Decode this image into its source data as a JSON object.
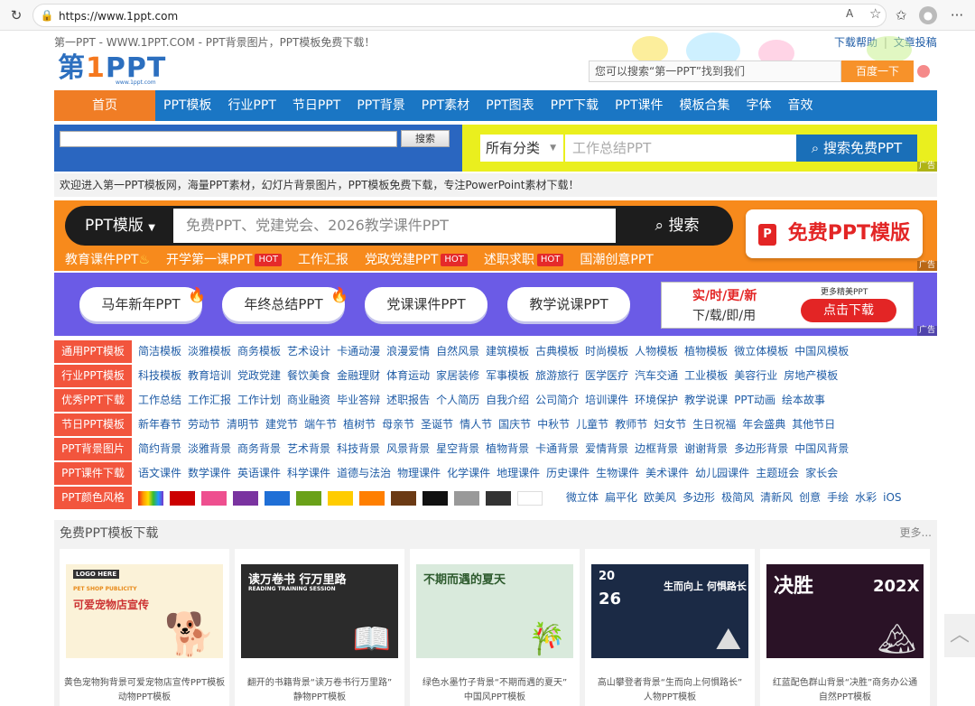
{
  "browser": {
    "url": "https://www.1ppt.com",
    "read_aloud": "A",
    "menu": "···"
  },
  "top_strip": {
    "slogan": "第一PPT - WWW.1PPT.COM - PPT背景图片，PPT模板免费下载！",
    "links": [
      "下载帮助",
      "文章投稿"
    ],
    "separator": "|"
  },
  "logo": {
    "text_a": "第",
    "text_b": "1",
    "text_c": "PPT",
    "url_text": "www.1ppt.com"
  },
  "top_search": {
    "placeholder": "您可以搜索“第一PPT”找到我们",
    "button": "百度一下"
  },
  "nav": {
    "home": "首页",
    "items": [
      "PPT模板",
      "行业PPT",
      "节日PPT",
      "PPT背景",
      "PPT素材",
      "PPT图表",
      "PPT下载",
      "PPT课件",
      "模板合集",
      "字体",
      "音效"
    ]
  },
  "search_band": {
    "left_button": "搜索",
    "select_value": "所有分类",
    "right_placeholder": "工作总结PPT",
    "right_button": "搜索免费PPT",
    "ad_label": "广告"
  },
  "welcome": "欢迎进入第一PPT模板网，海量PPT素材，幻灯片背景图片，PPT模板免费下载，专注PowerPoint素材下载！",
  "orange_banner": {
    "dropdown": "PPT模版",
    "placeholder": "免费PPT、党建党会、2026教学课件PPT",
    "search": "搜索",
    "cta": "免费PPT模版",
    "hot_label": "HOT",
    "keywords": [
      {
        "text": "教育课件PPT",
        "hot": false
      },
      {
        "text": "开学第一课PPT",
        "hot": true
      },
      {
        "text": "工作汇报",
        "hot": false
      },
      {
        "text": "党政党建PPT",
        "hot": true
      },
      {
        "text": "述职求职",
        "hot": true
      },
      {
        "text": "国潮创意PPT",
        "hot": false
      }
    ],
    "ad_label": "广告"
  },
  "purple_banner": {
    "buttons": [
      "马年新年PPT",
      "年终总结PPT",
      "党课课件PPT",
      "教学说课PPT"
    ],
    "ad_line1": "实/时/更/新",
    "ad_line2": "下/载/即/用",
    "ad_line3": "更多精美PPT",
    "ad_button": "点击下载",
    "ad_label": "广告"
  },
  "categories": [
    {
      "label": "通用PPT模板",
      "links": [
        "简洁模板",
        "淡雅模板",
        "商务模板",
        "艺术设计",
        "卡通动漫",
        "浪漫爱情",
        "自然风景",
        "建筑模板",
        "古典模板",
        "时尚模板",
        "人物模板",
        "植物模板",
        "微立体模板",
        "中国风模板"
      ]
    },
    {
      "label": "行业PPT模板",
      "links": [
        "科技模板",
        "教育培训",
        "党政党建",
        "餐饮美食",
        "金融理财",
        "体育运动",
        "家居装修",
        "军事模板",
        "旅游旅行",
        "医学医疗",
        "汽车交通",
        "工业模板",
        "美容行业",
        "房地产模板"
      ]
    },
    {
      "label": "优秀PPT下载",
      "links": [
        "工作总结",
        "工作汇报",
        "工作计划",
        "商业融资",
        "毕业答辩",
        "述职报告",
        "个人简历",
        "自我介绍",
        "公司简介",
        "培训课件",
        "环境保护",
        "教学说课",
        "PPT动画",
        "绘本故事"
      ]
    },
    {
      "label": "节日PPT模板",
      "links": [
        "新年春节",
        "劳动节",
        "清明节",
        "建党节",
        "端午节",
        "植树节",
        "母亲节",
        "圣诞节",
        "情人节",
        "国庆节",
        "中秋节",
        "儿童节",
        "教师节",
        "妇女节",
        "生日祝福",
        "年会盛典",
        "其他节日"
      ]
    },
    {
      "label": "PPT背景图片",
      "links": [
        "简约背景",
        "淡雅背景",
        "商务背景",
        "艺术背景",
        "科技背景",
        "风景背景",
        "星空背景",
        "植物背景",
        "卡通背景",
        "爱情背景",
        "边框背景",
        "谢谢背景",
        "多边形背景",
        "中国风背景"
      ]
    },
    {
      "label": "PPT课件下载",
      "links": [
        "语文课件",
        "数学课件",
        "英语课件",
        "科学课件",
        "道德与法治",
        "物理课件",
        "化学课件",
        "地理课件",
        "历史课件",
        "生物课件",
        "美术课件",
        "幼儿园课件",
        "主题班会",
        "家长会"
      ]
    },
    {
      "label": "PPT颜色风格",
      "swatches": [
        "#d22",
        "#cc0000",
        "#ee4f8f",
        "#7a33a0",
        "#1f6fd6",
        "#6aa119",
        "#ffcc00",
        "#ff7f00",
        "#6b3a14",
        "#111111",
        "#999999",
        "#333333",
        "#ffffff"
      ],
      "links": [
        "微立体",
        "扁平化",
        "欧美风",
        "多边形",
        "极简风",
        "清新风",
        "创意",
        "手绘",
        "水彩",
        "iOS"
      ]
    }
  ],
  "free_section": {
    "title": "免费PPT模板下载",
    "more": "更多...",
    "cards": [
      {
        "caption1": "黄色宠物狗背景可爱宠物店宣传PPT模板",
        "caption2": "动物PPT模板",
        "t1": "LOGO HERE",
        "t2": "PET SHOP PUBLICITY",
        "t3": "可爱宠物店宣传",
        "bg": "#fbf2d8",
        "icon": "dog-icon"
      },
      {
        "caption1": "翻开的书籍背景“读万卷书行万里路”",
        "caption2": "静物PPT模板",
        "t1": "读万卷书 行万里路",
        "t2": "READING TRAINING SESSION",
        "t3": "",
        "bg": "#2b2b2b",
        "icon": "book-icon"
      },
      {
        "caption1": "绿色水墨竹子背景“不期而遇的夏天”",
        "caption2": "中国风PPT模板",
        "t1": "不期而遇的夏天",
        "t2": "",
        "t3": "",
        "bg": "#d9eadc",
        "icon": "bamboo-icon"
      },
      {
        "caption1": "高山攀登者背景“生而向上何惧路长”",
        "caption2": "人物PPT模板",
        "t1": "20",
        "t2": "26",
        "t3": "生而向上 何惧路长",
        "bg": "#1b2a45",
        "icon": "mountain-icon"
      },
      {
        "caption1": "红蓝配色群山背景“决胜”商务办公通",
        "caption2": "自然PPT模板",
        "t1": "决胜",
        "t2": "202X",
        "t3": "",
        "bg": "#2a1226",
        "icon": "peaks-icon"
      }
    ]
  },
  "scroll_top": "︿"
}
